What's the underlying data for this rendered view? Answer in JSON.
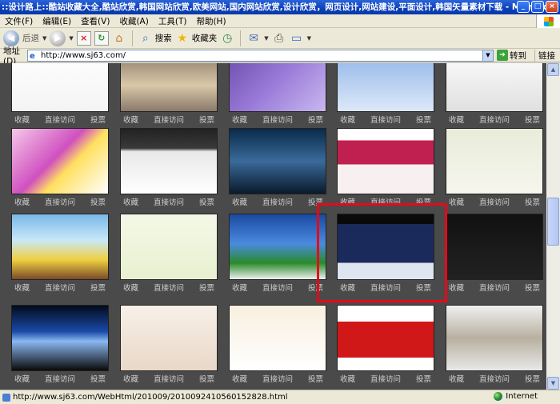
{
  "window": {
    "title": "::设计路上::酷站收藏大全,酷站欣赏,韩国网站欣赏,欧美网站,国内网站欣赏,设计欣赏，网页设计,网站建设,平面设计,韩国矢量素材下载 - Microsoft Internet Explorer"
  },
  "menu": {
    "items": [
      "文件(F)",
      "编辑(E)",
      "查看(V)",
      "收藏(A)",
      "工具(T)",
      "帮助(H)"
    ]
  },
  "toolbar": {
    "back_label": "后退",
    "search_label": "搜索",
    "favorites_label": "收藏夹"
  },
  "address": {
    "label": "地址(D)",
    "url": "http://www.sj63.com/",
    "go_label": "转到",
    "links_label": "链接"
  },
  "card_labels": {
    "collect": "收藏",
    "visit": "直接访问",
    "vote": "投票"
  },
  "status": {
    "url": "http://www.sj63.com/WebHtml/201009/2010092410560152828.html",
    "zone": "Internet"
  },
  "colors": {
    "highlight": "#e8081a",
    "titlebar": "#0a3fb8",
    "page_bg": "#4a4a4a"
  }
}
